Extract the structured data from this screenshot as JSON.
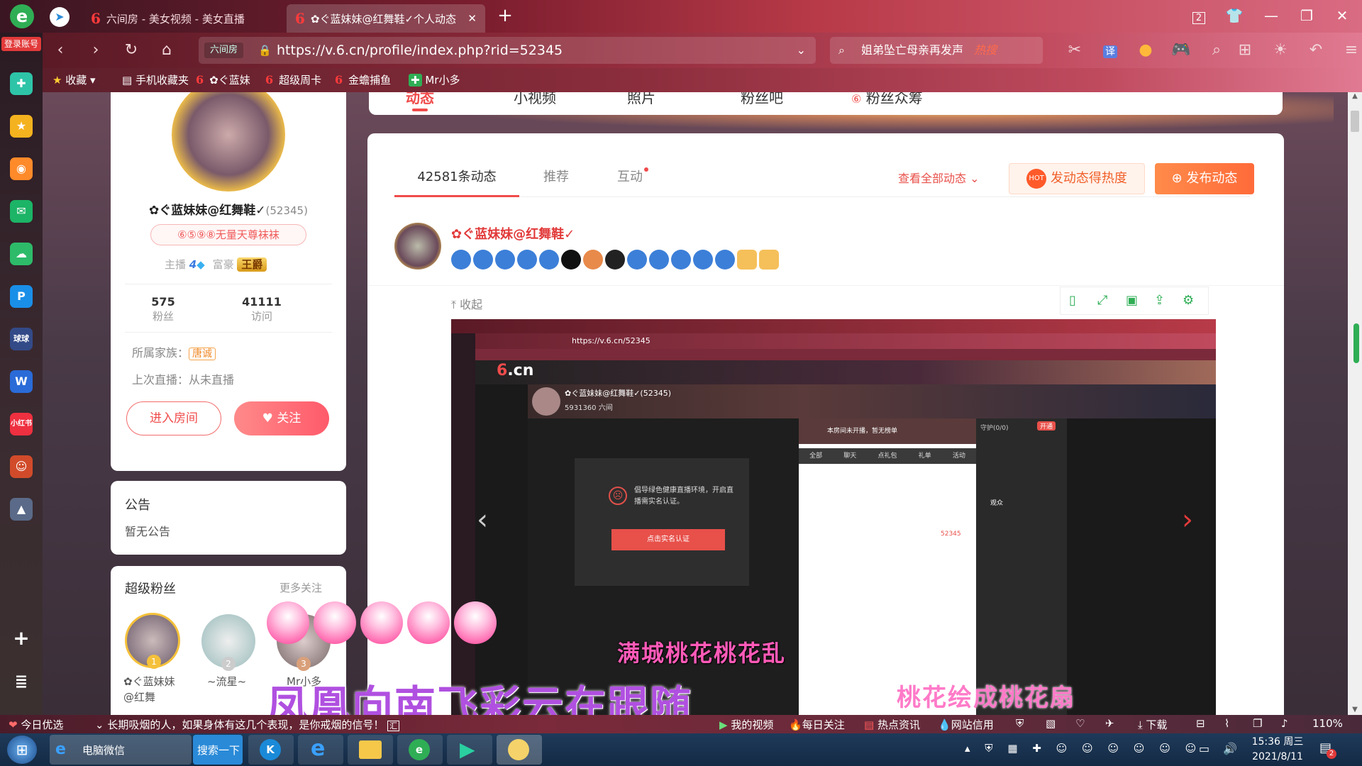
{
  "browser": {
    "side_label": "登录账号",
    "tabs": [
      {
        "label": "六间房 - 美女视频 - 美女直播"
      },
      {
        "label": "✿ぐ蓝妹妹@红舞鞋✓个人动态"
      }
    ],
    "tab_counter": "2",
    "url": "https://v.6.cn/profile/index.php?rid=52345",
    "url_badge": "六间房",
    "search_text": "姐弟坠亡母亲再发声",
    "search_hot": "热搜",
    "bookmarks": [
      "收藏",
      "手机收藏夹",
      "✿ぐ蓝妹",
      "超级周卡",
      "金蟾捕鱼",
      "Mr小多"
    ]
  },
  "profile_tabs": [
    "动态",
    "小视频",
    "照片",
    "粉丝吧",
    "粉丝众筹"
  ],
  "profile": {
    "name": "✿ぐ蓝妹妹@红舞鞋✓",
    "rid": "(52345)",
    "medal": "⑥⑤⑨⑧无量天尊袜袜",
    "anchor_label": "主播",
    "anchor_level": "4",
    "rich_label": "富豪",
    "rich_level": "王爵",
    "fans_count": "575",
    "fans_label": "粉丝",
    "visits_count": "41111",
    "visits_label": "访问",
    "family_label": "所属家族：",
    "family_value": "唐诚",
    "last_live": "上次直播：从未直播",
    "enter_room": "进入房间",
    "follow": "关注"
  },
  "notice": {
    "title": "公告",
    "content": "暂无公告"
  },
  "super_fans": {
    "title": "超级粉丝",
    "more": "更多关注",
    "fans": [
      {
        "rank": "1",
        "name": "✿ぐ蓝妹妹@红舞"
      },
      {
        "rank": "2",
        "name": "~流星~"
      },
      {
        "rank": "3",
        "name": "Mr小多"
      }
    ]
  },
  "feed": {
    "tabs": [
      "42581条动态",
      "推荐",
      "互动"
    ],
    "view_all": "查看全部动态",
    "hot_button": "发动态得热度",
    "post_button": "发布动态",
    "post_author": "✿ぐ蓝妹妹@红舞鞋✓",
    "collapse": "收起"
  },
  "embedded": {
    "url": "https://v.6.cn/52345",
    "name": "✿ぐ蓝妹妹@红舞鞋✓(52345)",
    "room_id": "5931360 六间",
    "dialog_text": "倡导绿色健康直播环境，开启直播需实名认证。",
    "dialog_button": "点击实名认证",
    "chat_tabs": [
      "全部",
      "聊天",
      "点礼包",
      "礼单",
      "活动"
    ],
    "notice_line": "本房间未开播，暂无榜单",
    "audience_label": "观众",
    "guard_label": "守护(0/0)",
    "gift_label": "开通",
    "user_count": "52345"
  },
  "lyrics": {
    "line1": "满城桃花桃花乱",
    "line2": "凤凰向南飞彩云在跟随",
    "line3": "桃花绘成桃花扇"
  },
  "statusbar": {
    "news": "今日优选",
    "headline": "长期吸烟的人，如果身体有这几个表现，是你戒烟的信号！",
    "headline_tag": "汇",
    "items": [
      "我的视频",
      "每日关注",
      "热点资讯",
      "网站信用",
      "下载"
    ],
    "zoom": "110%"
  },
  "taskbar": {
    "app1": "电脑微信",
    "app2": "搜索一下",
    "time": "15:36 周三",
    "date": "2021/8/11",
    "badge": "2"
  },
  "colors": {
    "accent": "#f04b4b",
    "brand_orange": "#ff7a3c",
    "link_red": "#e8504a"
  }
}
